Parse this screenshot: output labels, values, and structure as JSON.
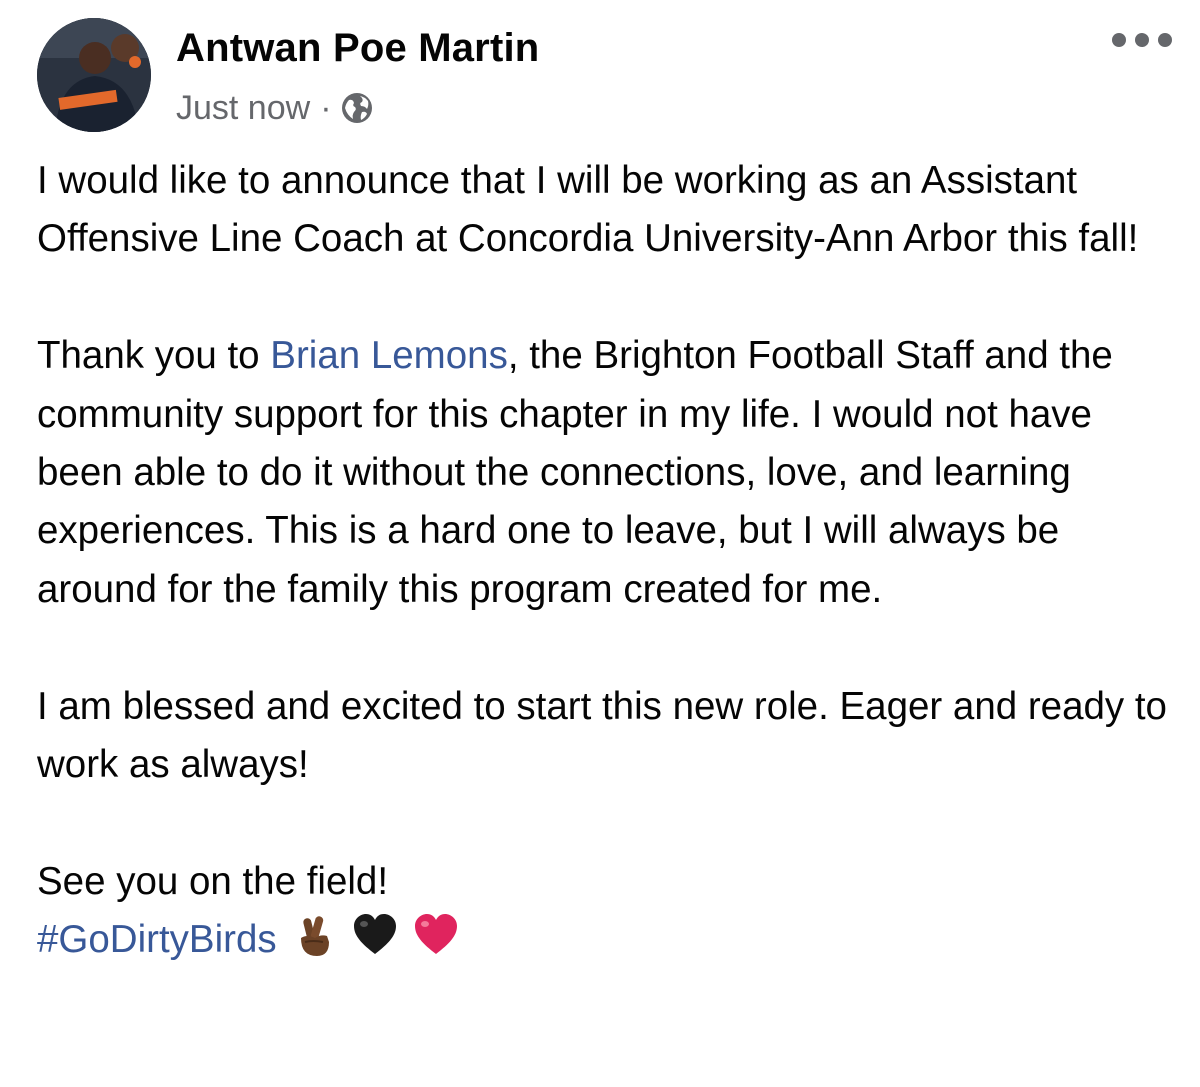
{
  "author": {
    "name": "Antwan Poe Martin",
    "avatar_alt": "profile-photo"
  },
  "meta": {
    "timestamp": "Just now",
    "separator": "·",
    "privacy_icon": "globe-icon"
  },
  "actions": {
    "more_icon": "more-options-icon"
  },
  "post": {
    "p1": "I would like to announce that I will be working as an Assistant Offensive Line Coach at Concordia University-Ann Arbor this fall!",
    "p2_pre": "Thank you to ",
    "p2_mention": "Brian Lemons",
    "p2_post": ", the Brighton Football Staff and the community support for this chapter in my life. I would not have been able to do it without the connections, love, and learning experiences. This is a hard one to leave, but I will always be around for the family this program created for me.",
    "p3": "I am blessed and excited to start this new role. Eager and ready to work as always!",
    "p4": "See you on the field!",
    "hashtag": "#GoDirtyBirds",
    "emojis": [
      "crossed-fingers-icon",
      "black-heart-icon",
      "red-heart-icon"
    ]
  },
  "colors": {
    "link": "#385898",
    "secondary_text": "#65676b",
    "heart_red": "#e0245e"
  }
}
